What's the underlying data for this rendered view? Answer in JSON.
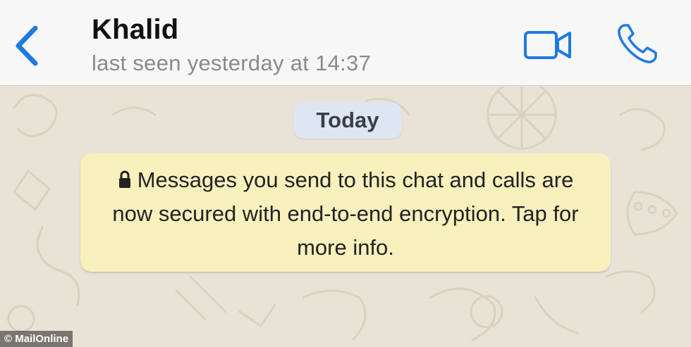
{
  "header": {
    "contact_name": "Khalid",
    "status": "last seen yesterday at 14:37",
    "back_icon": "chevron-left-icon",
    "video_icon": "video-camera-icon",
    "call_icon": "phone-icon"
  },
  "chat": {
    "date_label": "Today",
    "encryption_notice": "Messages you send to this chat and calls are now secured with end-to-end encryption. Tap for more info.",
    "notice_icon": "lock-icon"
  },
  "watermark": "© MailOnline",
  "colors": {
    "accent": "#1f7ae0",
    "header_bg": "#f7f7f7",
    "notice_bg": "#f8f0bd",
    "date_bg": "#dde6f2",
    "status_text": "#8a8a8a"
  }
}
